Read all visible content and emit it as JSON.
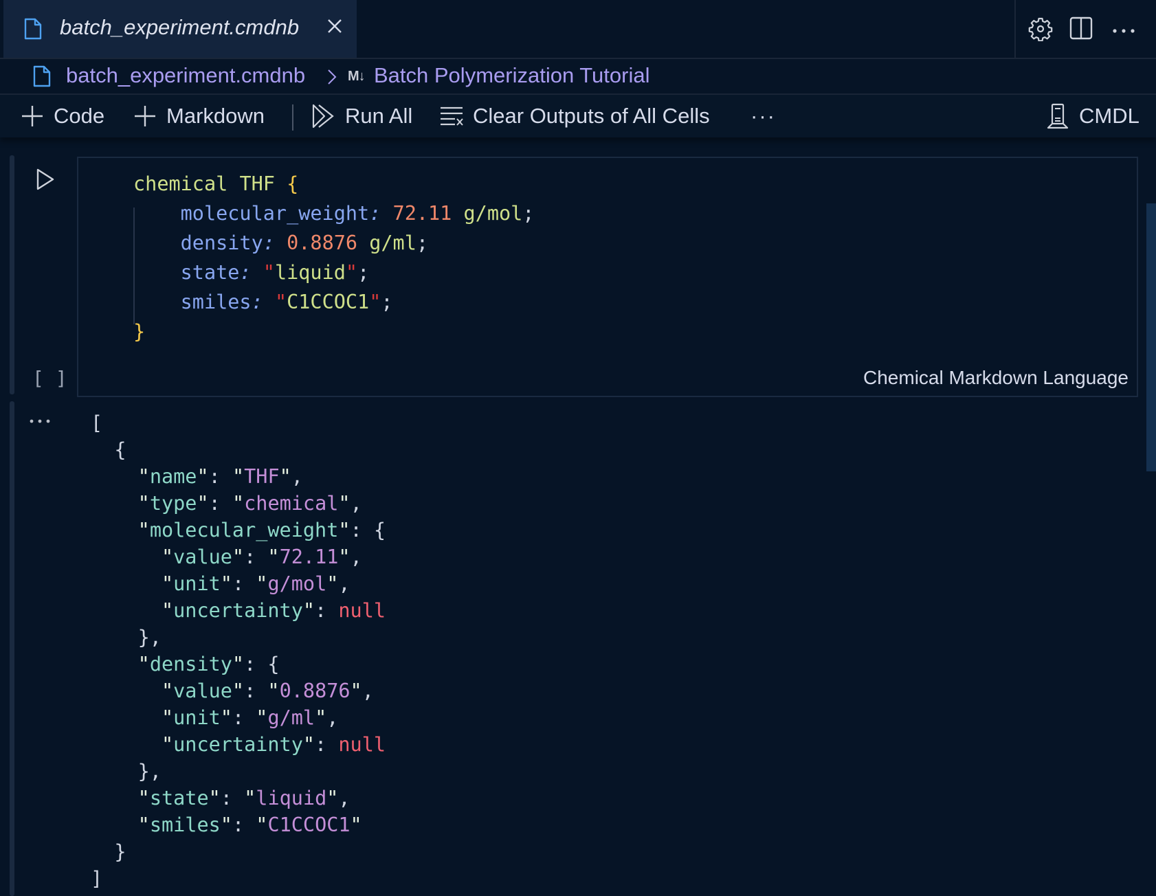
{
  "tab": {
    "title": "batch_experiment.cmdnb",
    "file_icon": "file-icon",
    "close_icon": "close-icon"
  },
  "tab_actions": [
    {
      "name": "settings",
      "icon": "gear-icon"
    },
    {
      "name": "split-editor",
      "icon": "split-editor-icon"
    },
    {
      "name": "more-actions",
      "icon": "ellipsis-icon"
    }
  ],
  "breadcrumb": {
    "file": "batch_experiment.cmdnb",
    "separator_icon": "chevron-right-icon",
    "markdown_badge": "M↓",
    "section": "Batch Polymerization Tutorial"
  },
  "toolbar": {
    "add_code": "Code",
    "add_markdown": "Markdown",
    "run_all": "Run All",
    "clear_outputs": "Clear Outputs of All Cells",
    "more": "···",
    "kernel": "CMDL"
  },
  "cell": {
    "execution_count": "[ ]",
    "language": "Chemical Markdown Language",
    "code": {
      "keyword": "chemical",
      "name": "THF",
      "open_brace": "{",
      "close_brace": "}",
      "properties": [
        {
          "key": "molecular_weight",
          "number": "72.11",
          "unit": "g/mol"
        },
        {
          "key": "density",
          "number": "0.8876",
          "unit": "g/ml"
        },
        {
          "key": "state",
          "string": "liquid"
        },
        {
          "key": "smiles",
          "string": "C1CCOC1"
        }
      ]
    }
  },
  "output": {
    "more_icon": "ellipsis-icon",
    "json": {
      "name": "THF",
      "type": "chemical",
      "molecular_weight": {
        "value": "72.11",
        "unit": "g/mol",
        "uncertainty": "null"
      },
      "density": {
        "value": "0.8876",
        "unit": "g/ml",
        "uncertainty": "null"
      },
      "state": "liquid",
      "smiles": "C1CCOC1"
    }
  },
  "colors": {
    "background": "#061426",
    "tab_active": "#13243d",
    "accent_link": "#a99cf0",
    "json_key": "#8ed8c8",
    "json_string": "#c58fd8",
    "json_null": "#f06070"
  }
}
